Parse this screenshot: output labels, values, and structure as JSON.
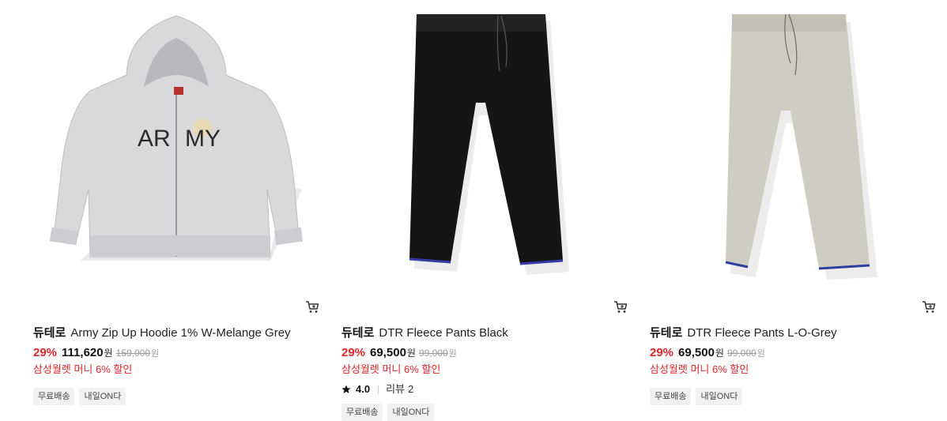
{
  "products": [
    {
      "brand": "듀테로",
      "name": "Army Zip Up Hoodie 1% W-Melange Grey",
      "discount": "29%",
      "price": "111,620",
      "currency": "원",
      "original_price": "159,000",
      "original_currency": "원",
      "promo": "삼성월렛 머니 6% 할인",
      "tags": [
        "무료배송",
        "내일ON다"
      ],
      "image_icon": "hoodie-image",
      "print_text_left": "AR",
      "print_text_right": "MY"
    },
    {
      "brand": "듀테로",
      "name": "DTR Fleece Pants Black",
      "discount": "29%",
      "price": "69,500",
      "currency": "원",
      "original_price": "99,000",
      "original_currency": "원",
      "promo": "삼성월렛 머니 6% 할인",
      "rating": "4.0",
      "review_label": "리뷰",
      "review_count": "2",
      "tags": [
        "무료배송",
        "내일ON다"
      ],
      "image_icon": "pants-image",
      "pants_color": "#151515"
    },
    {
      "brand": "듀테로",
      "name": "DTR Fleece Pants L-O-Grey",
      "discount": "29%",
      "price": "69,500",
      "currency": "원",
      "original_price": "99,000",
      "original_currency": "원",
      "promo": "삼성월렛 머니 6% 할인",
      "tags": [
        "무료배송",
        "내일ON다"
      ],
      "image_icon": "pants-image",
      "pants_color": "#cfcdc2"
    }
  ],
  "colors": {
    "discount": "#e0262d",
    "hem_trim": "#3a3aa8"
  }
}
